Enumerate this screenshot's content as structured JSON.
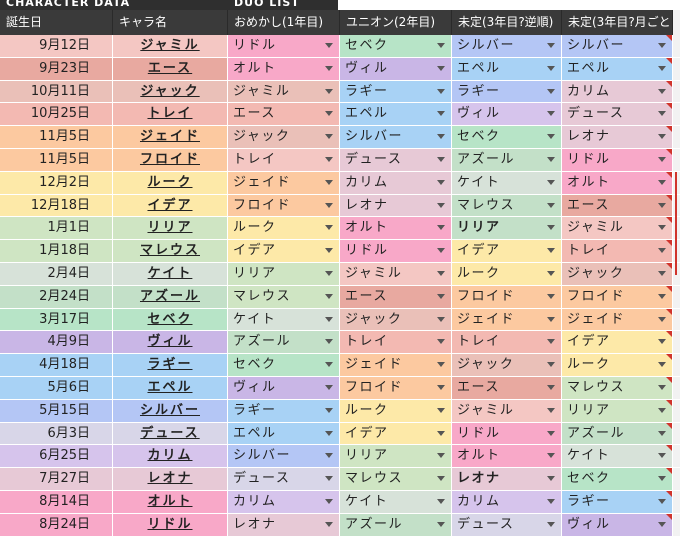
{
  "top_labels": {
    "left": "CHARACTER DATA",
    "right": "DUO LIST"
  },
  "headers": [
    "誕生日",
    "キャラ名",
    "おめかし(1年目)",
    "ユニオン(2年目)",
    "未定(3年目?逆順)",
    "未定(3年目?月ごと"
  ],
  "rows": [
    {
      "date": "9月12日",
      "name": "ジャミル",
      "d": [
        "リドル",
        "セベク",
        "シルバー",
        "シルバー"
      ],
      "bg": "#f4c7c3",
      "dc": [
        "#f8a8c8",
        "#b7e4c7",
        "#b4c6f5",
        "#b4c6f5"
      ]
    },
    {
      "date": "9月23日",
      "name": "エース",
      "d": [
        "オルト",
        "ヴィル",
        "エペル",
        "エペル"
      ],
      "bg": "#e8a9a0",
      "dc": [
        "#f8a8c8",
        "#c9b6e6",
        "#a8d2f5",
        "#a8d2f5"
      ]
    },
    {
      "date": "10月11日",
      "name": "ジャック",
      "d": [
        "ジャミル",
        "ラギー",
        "ラギー",
        "カリム"
      ],
      "bg": "#eac0b8",
      "dc": [
        "#eac0b8",
        "#a8d2f5",
        "#b4c6f5",
        "#e7c9d6"
      ]
    },
    {
      "date": "10月25日",
      "name": "トレイ",
      "d": [
        "エース",
        "エペル",
        "ヴィル",
        "デュース"
      ],
      "bg": "#f3b9b2",
      "dc": [
        "#f3b9b2",
        "#a8d2f5",
        "#d6c4ec",
        "#e7c9d6"
      ]
    },
    {
      "date": "11月5日",
      "name": "ジェイド",
      "d": [
        "ジャック",
        "シルバー",
        "セベク",
        "レオナ"
      ],
      "bg": "#fcc9a0",
      "dc": [
        "#eac0b8",
        "#a8d2f5",
        "#b7e4c7",
        "#e7c9d6"
      ]
    },
    {
      "date": "11月5日",
      "name": "フロイド",
      "d": [
        "トレイ",
        "デュース",
        "アズール",
        "リドル"
      ],
      "bg": "#fcc9a0",
      "dc": [
        "#f4c7c3",
        "#e7c9d6",
        "#c3e0c8",
        "#f8a8c8"
      ]
    },
    {
      "date": "12月2日",
      "name": "ルーク",
      "d": [
        "ジェイド",
        "カリム",
        "ケイト",
        "オルト"
      ],
      "bg": "#fde9a8",
      "dc": [
        "#fcc9a0",
        "#e7c9d6",
        "#d7e2d9",
        "#f8a8c8"
      ]
    },
    {
      "date": "12月18日",
      "name": "イデア",
      "d": [
        "フロイド",
        "レオナ",
        "マレウス",
        "エース"
      ],
      "bg": "#fde9a8",
      "dc": [
        "#fcc9a0",
        "#e7c9d6",
        "#c3e0c8",
        "#e8a9a0"
      ]
    },
    {
      "date": "1月1日",
      "name": "リリア",
      "d": [
        "ルーク",
        "オルト",
        "リリア",
        "ジャミル"
      ],
      "bg": "#cfe5c3",
      "dc": [
        "#fde9a8",
        "#f8a8c8",
        "#c3e0c8",
        "#f4c7c3"
      ],
      "b2": true
    },
    {
      "date": "1月18日",
      "name": "マレウス",
      "d": [
        "イデア",
        "リドル",
        "イデア",
        "トレイ"
      ],
      "bg": "#cfe5c3",
      "dc": [
        "#fde9a8",
        "#f8a8c8",
        "#fde9a8",
        "#f3b9b2"
      ]
    },
    {
      "date": "2月4日",
      "name": "ケイト",
      "d": [
        "リリア",
        "ジャミル",
        "ルーク",
        "ジャック"
      ],
      "bg": "#d7e2d9",
      "dc": [
        "#cfe5c3",
        "#f4c7c3",
        "#fde9a8",
        "#eac0b8"
      ]
    },
    {
      "date": "2月24日",
      "name": "アズール",
      "d": [
        "マレウス",
        "エース",
        "フロイド",
        "フロイド"
      ],
      "bg": "#c3e0c8",
      "dc": [
        "#cfe5c3",
        "#e8a9a0",
        "#fcc9a0",
        "#fcc9a0"
      ]
    },
    {
      "date": "3月17日",
      "name": "セベク",
      "d": [
        "ケイト",
        "ジャック",
        "ジェイド",
        "ジェイド"
      ],
      "bg": "#b7e4c7",
      "dc": [
        "#d7e2d9",
        "#eac0b8",
        "#fcc9a0",
        "#fcc9a0"
      ]
    },
    {
      "date": "4月9日",
      "name": "ヴィル",
      "d": [
        "アズール",
        "トレイ",
        "トレイ",
        "イデア"
      ],
      "bg": "#c9b6e6",
      "dc": [
        "#c3e0c8",
        "#f3b9b2",
        "#f3b9b2",
        "#fde9a8"
      ]
    },
    {
      "date": "4月18日",
      "name": "ラギー",
      "d": [
        "セベク",
        "ジェイド",
        "ジャック",
        "ルーク"
      ],
      "bg": "#a8d2f5",
      "dc": [
        "#b7e4c7",
        "#fcc9a0",
        "#eac0b8",
        "#fde9a8"
      ]
    },
    {
      "date": "5月6日",
      "name": "エペル",
      "d": [
        "ヴィル",
        "フロイド",
        "エース",
        "マレウス"
      ],
      "bg": "#a8d2f5",
      "dc": [
        "#c9b6e6",
        "#fcc9a0",
        "#e8a9a0",
        "#cfe5c3"
      ]
    },
    {
      "date": "5月15日",
      "name": "シルバー",
      "d": [
        "ラギー",
        "ルーク",
        "ジャミル",
        "リリア"
      ],
      "bg": "#b4c6f5",
      "dc": [
        "#a8d2f5",
        "#fde9a8",
        "#f4c7c3",
        "#cfe5c3"
      ]
    },
    {
      "date": "6月3日",
      "name": "デュース",
      "d": [
        "エペル",
        "イデア",
        "リドル",
        "アズール"
      ],
      "bg": "#d8d6e8",
      "dc": [
        "#a8d2f5",
        "#fde9a8",
        "#f8a8c8",
        "#c3e0c8"
      ]
    },
    {
      "date": "6月25日",
      "name": "カリム",
      "d": [
        "シルバー",
        "リリア",
        "オルト",
        "ケイト"
      ],
      "bg": "#d6c4ec",
      "dc": [
        "#b4c6f5",
        "#cfe5c3",
        "#f8a8c8",
        "#d7e2d9"
      ]
    },
    {
      "date": "7月27日",
      "name": "レオナ",
      "d": [
        "デュース",
        "マレウス",
        "レオナ",
        "セベク"
      ],
      "bg": "#e7c9d6",
      "dc": [
        "#d8d6e8",
        "#cfe5c3",
        "#e7c9d6",
        "#b7e4c7"
      ],
      "b3": true
    },
    {
      "date": "8月14日",
      "name": "オルト",
      "d": [
        "カリム",
        "ケイト",
        "カリム",
        "ラギー"
      ],
      "bg": "#f8a8c8",
      "dc": [
        "#d6c4ec",
        "#d7e2d9",
        "#d6c4ec",
        "#a8d2f5"
      ]
    },
    {
      "date": "8月24日",
      "name": "リドル",
      "d": [
        "レオナ",
        "アズール",
        "デュース",
        "ヴィル"
      ],
      "bg": "#f8a8c8",
      "dc": [
        "#e7c9d6",
        "#c3e0c8",
        "#d8d6e8",
        "#c9b6e6"
      ]
    }
  ]
}
